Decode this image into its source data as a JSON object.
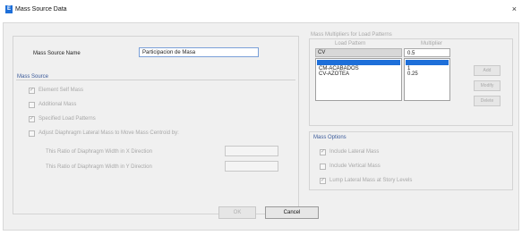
{
  "window": {
    "title": "Mass Source Data",
    "close_glyph": "×",
    "icon_letter": "E"
  },
  "mass_source_name": {
    "label": "Mass Source Name",
    "value": "Participacion de Masa"
  },
  "mass_source": {
    "title": "Mass Source",
    "options": [
      {
        "label": "Element Self Mass",
        "checked": true
      },
      {
        "label": "Additional Mass",
        "checked": false
      },
      {
        "label": "Specified Load Patterns",
        "checked": true
      },
      {
        "label": "Adjust Diaphragm Lateral Mass to Move Mass Centroid by:",
        "checked": false
      }
    ],
    "ratio_x_label": "This Ratio of Diaphragm Width in X Direction",
    "ratio_y_label": "This Ratio of Diaphragm Width in Y Direction"
  },
  "multipliers": {
    "title": "Mass Multipliers for Load Patterns",
    "col_pattern": "Load Pattern",
    "col_multiplier": "Multiplier",
    "edit_pattern": "CV",
    "edit_multiplier": "0.5",
    "patterns": [
      "",
      "CM-ACABADOS",
      "CV-AZOTEA"
    ],
    "multiplier_values": [
      "",
      "1",
      "0.25"
    ],
    "selected_index": 0,
    "buttons": {
      "add": "Add",
      "modify": "Modify",
      "delete": "Delete"
    }
  },
  "mass_options": {
    "title": "Mass Options",
    "options": [
      {
        "label": "Include Lateral Mass",
        "checked": true
      },
      {
        "label": "Include Vertical Mass",
        "checked": false
      },
      {
        "label": "Lump Lateral Mass at Story Levels",
        "checked": true
      }
    ]
  },
  "footer": {
    "ok_label": "OK",
    "cancel_label": "Cancel"
  },
  "checkmark_glyph": "✓"
}
